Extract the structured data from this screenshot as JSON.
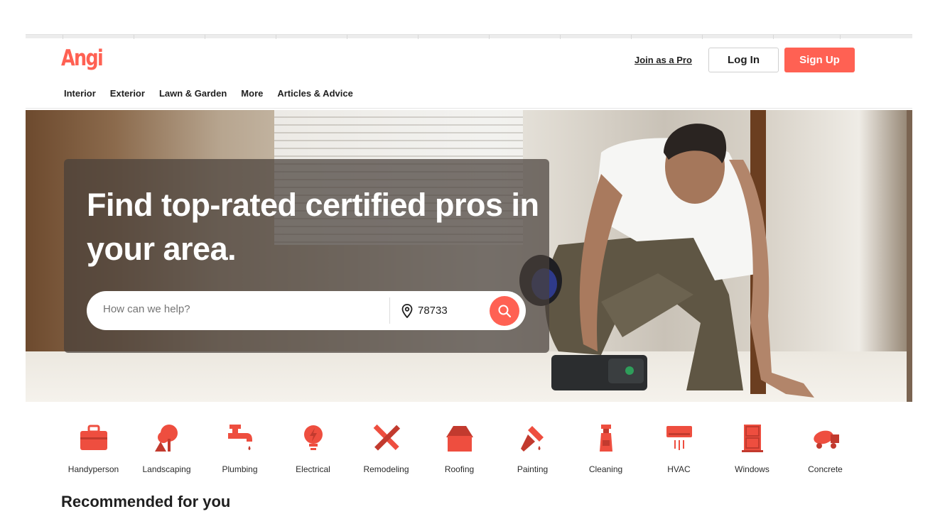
{
  "brand": {
    "logo_text": "Angi",
    "accent": "#ff6153"
  },
  "header": {
    "join_label": "Join as a Pro",
    "login_label": "Log In",
    "signup_label": "Sign Up"
  },
  "nav": {
    "items": [
      "Interior",
      "Exterior",
      "Lawn & Garden",
      "More",
      "Articles & Advice"
    ]
  },
  "hero": {
    "headline": "Find top-rated certified pros in your area.",
    "search": {
      "placeholder": "How can we help?",
      "zip": "78733"
    }
  },
  "categories": [
    {
      "label": "Handyperson",
      "icon": "toolbox-icon"
    },
    {
      "label": "Landscaping",
      "icon": "tree-icon"
    },
    {
      "label": "Plumbing",
      "icon": "faucet-icon"
    },
    {
      "label": "Electrical",
      "icon": "lightbulb-icon"
    },
    {
      "label": "Remodeling",
      "icon": "ruler-pencil-icon"
    },
    {
      "label": "Roofing",
      "icon": "house-icon"
    },
    {
      "label": "Painting",
      "icon": "paintbrush-icon"
    },
    {
      "label": "Cleaning",
      "icon": "spray-bottle-icon"
    },
    {
      "label": "HVAC",
      "icon": "air-conditioner-icon"
    },
    {
      "label": "Windows",
      "icon": "window-icon"
    },
    {
      "label": "Concrete",
      "icon": "cement-mixer-icon"
    }
  ],
  "recommended": {
    "title": "Recommended for you"
  }
}
